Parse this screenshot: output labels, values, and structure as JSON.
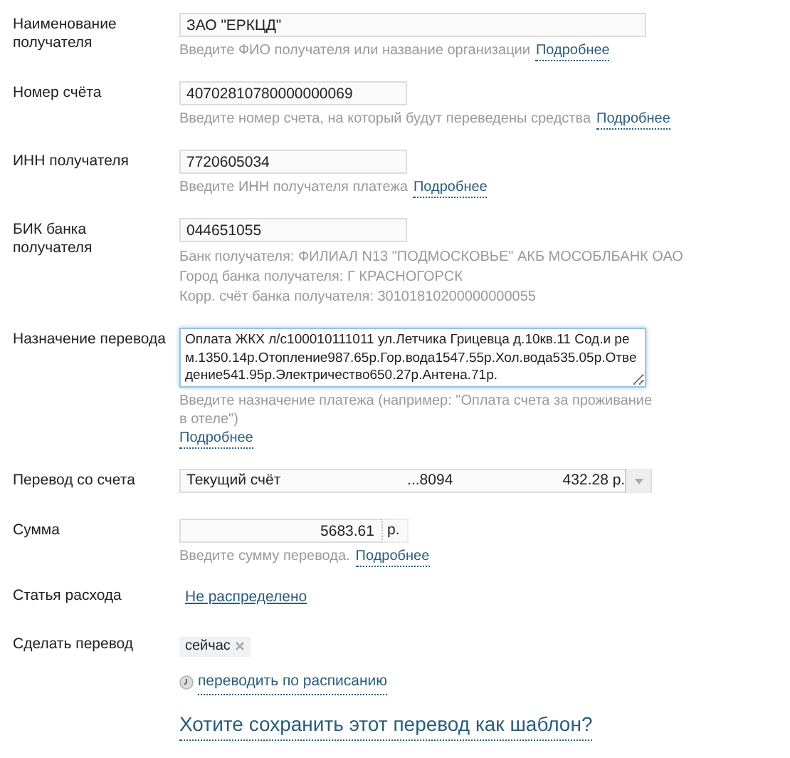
{
  "fields": [
    {
      "kind": "text",
      "label": "Наименование получателя",
      "value": "ЗАО \"ЕРКЦД\"",
      "wide": true,
      "hint": "Введите ФИО получателя или название организации",
      "hint_link": "Подробнее"
    },
    {
      "kind": "text",
      "label": "Номер счёта",
      "value": "40702810780000000069",
      "wide": false,
      "hint": "Введите номер счета, на который будут переведены средства",
      "hint_link": "Подробнее"
    },
    {
      "kind": "text",
      "label": "ИНН получателя",
      "value": "7720605034",
      "wide": false,
      "hint": "Введите ИНН получателя платежа",
      "hint_link": "Подробнее"
    },
    {
      "kind": "text",
      "label": "БИК банка получателя",
      "value": "044651055",
      "wide": false,
      "info": [
        "Банк получателя: ФИЛИАЛ N13 \"ПОДМОСКОВЬЕ\" АКБ МОСОБЛБАНК ОАО",
        "Город банка получателя: Г КРАСНОГОРСК",
        "Корр. счёт банка получателя: 30101810200000000055"
      ]
    },
    {
      "kind": "textarea",
      "label": "Назначение перевода",
      "value": "Оплата ЖКХ л/с100010111011 ул.Летчика Грицевца д.10кв.11 Сод.и рем.1350.14р.Отопление987.65р.Гор.вода1547.55р.Хол.вода535.05р.Отведение541.95р.Электричество650.27р.Антена.71р.",
      "hint": "Введите назначение платежа (например: \"Оплата счета за проживание в отеле\")",
      "hint_link": "Подробнее"
    },
    {
      "kind": "select",
      "label": "Перевод со счета",
      "account": "Текущий счёт",
      "number": "...8094",
      "balance": "432.28 р."
    },
    {
      "kind": "amount",
      "label": "Сумма",
      "value": "5683.61",
      "currency": "р.",
      "hint": "Введите сумму перевода.",
      "hint_link": "Подробнее"
    },
    {
      "kind": "link",
      "label": "Статья расхода",
      "link": "Не распределено"
    },
    {
      "kind": "chip",
      "label": "Сделать перевод",
      "chip": "сейчас",
      "schedule_link": "переводить по расписанию"
    }
  ],
  "save_template_link": "Хотите сохранить этот перевод как шаблон?"
}
